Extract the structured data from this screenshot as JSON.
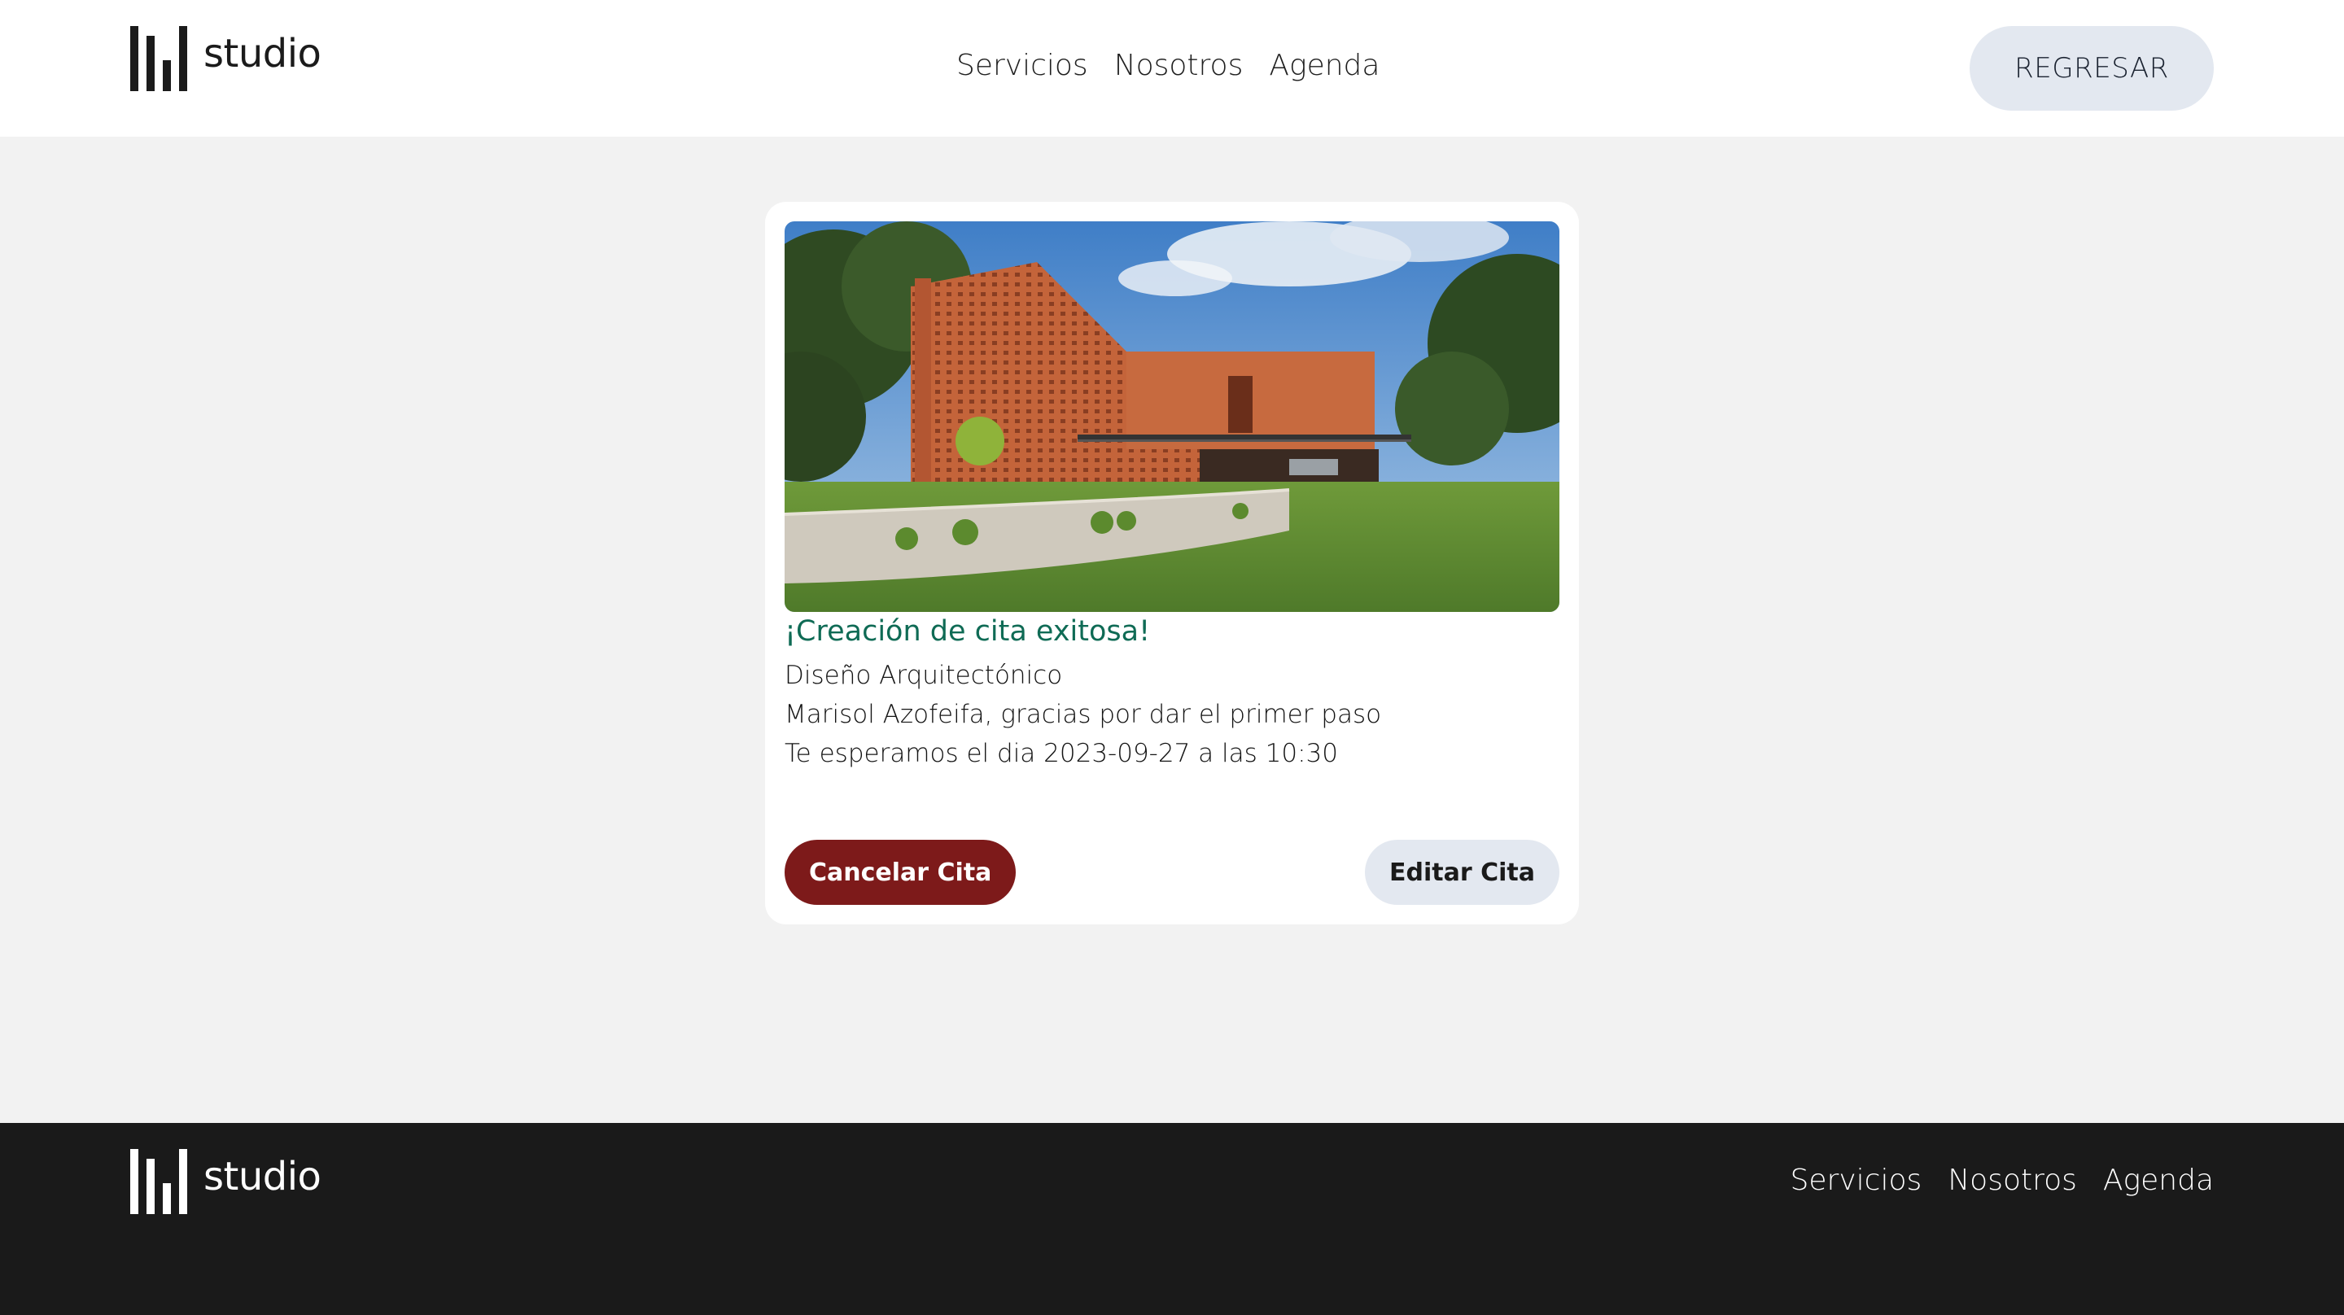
{
  "brand": {
    "name": "studio"
  },
  "header": {
    "nav": [
      {
        "label": "Servicios"
      },
      {
        "label": "Nosotros"
      },
      {
        "label": "Agenda"
      }
    ],
    "back_label": "REGRESAR"
  },
  "card": {
    "title": "¡Creación de cita exitosa!",
    "service": "Diseño Arquitectónico",
    "thanks": "Marisol Azofeifa, gracias por dar el primer paso",
    "schedule": "Te esperamos el dia 2023-09-27 a las 10:30",
    "cancel_label": "Cancelar Cita",
    "edit_label": "Editar Cita"
  },
  "footer": {
    "nav": [
      {
        "label": "Servicios"
      },
      {
        "label": "Nosotros"
      },
      {
        "label": "Agenda"
      }
    ]
  },
  "colors": {
    "success": "#0f6b55",
    "danger": "#7d1a1a",
    "neutral_button": "#e3e8f0",
    "footer_bg": "#1a1a1a"
  }
}
